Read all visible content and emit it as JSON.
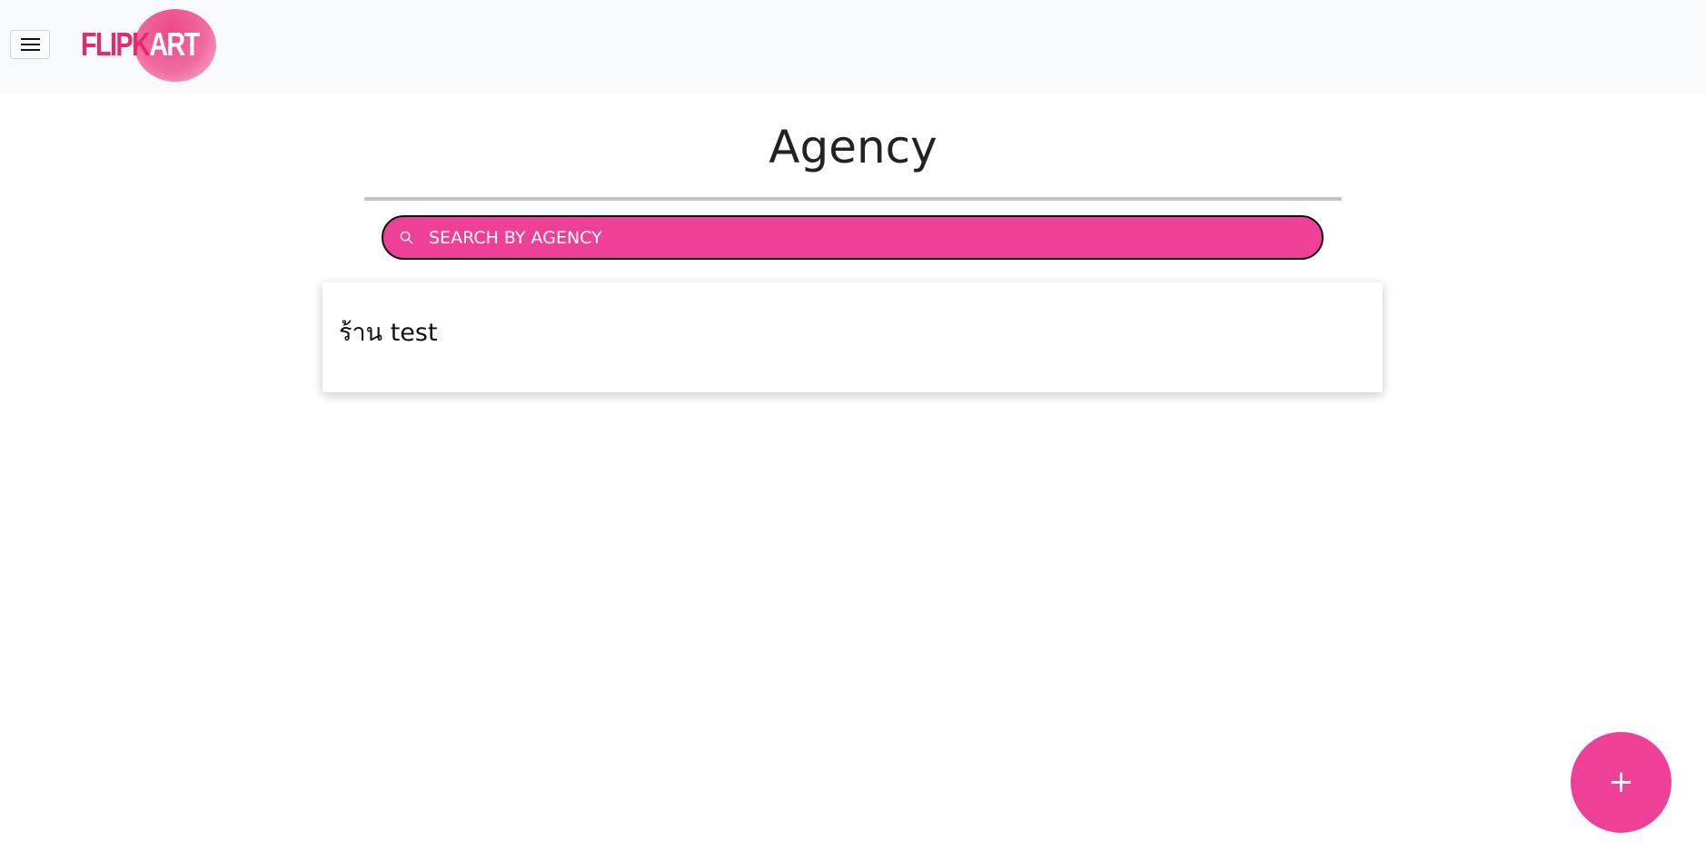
{
  "header": {
    "menu_icon": "hamburger-menu-icon",
    "logo": {
      "part1": "FLIPK",
      "part2": "ART"
    }
  },
  "page": {
    "title": "Agency"
  },
  "search": {
    "icon": "search-icon",
    "placeholder": "SEARCH BY AGENCY"
  },
  "agencies": [
    {
      "name": "ร้าน test"
    }
  ],
  "fab": {
    "label": "+"
  },
  "colors": {
    "accent": "#ee4097",
    "logo_pink": "#e8286f",
    "topbar_bg": "#f8f9fa",
    "divider": "#c4c4c4"
  }
}
